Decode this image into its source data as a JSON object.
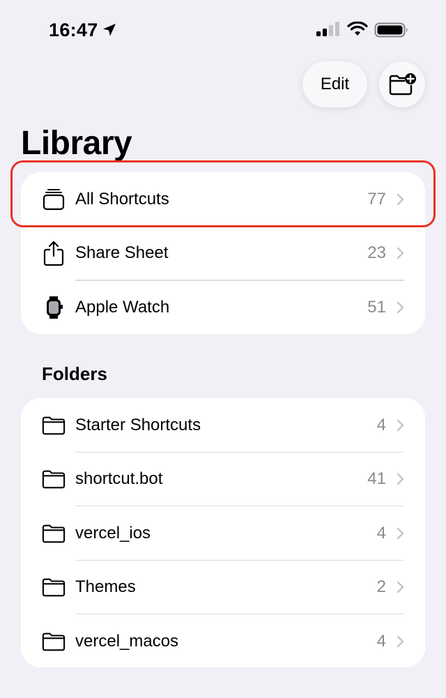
{
  "status_bar": {
    "time": "16:47"
  },
  "toolbar": {
    "edit_label": "Edit"
  },
  "page": {
    "title": "Library"
  },
  "library": {
    "items": [
      {
        "label": "All Shortcuts",
        "count": "77",
        "icon": "stack-icon"
      },
      {
        "label": "Share Sheet",
        "count": "23",
        "icon": "share-icon"
      },
      {
        "label": "Apple Watch",
        "count": "51",
        "icon": "watch-icon"
      }
    ]
  },
  "folders": {
    "header": "Folders",
    "items": [
      {
        "label": "Starter Shortcuts",
        "count": "4",
        "icon": "folder-icon"
      },
      {
        "label": "shortcut.bot",
        "count": "41",
        "icon": "folder-icon"
      },
      {
        "label": "vercel_ios",
        "count": "4",
        "icon": "folder-icon"
      },
      {
        "label": "Themes",
        "count": "2",
        "icon": "folder-icon"
      },
      {
        "label": "vercel_macos",
        "count": "4",
        "icon": "folder-icon"
      }
    ]
  },
  "colors": {
    "background": "#f1f0f6",
    "card": "#ffffff",
    "secondary_text": "#8a8a8e",
    "highlight": "#ea3323"
  }
}
